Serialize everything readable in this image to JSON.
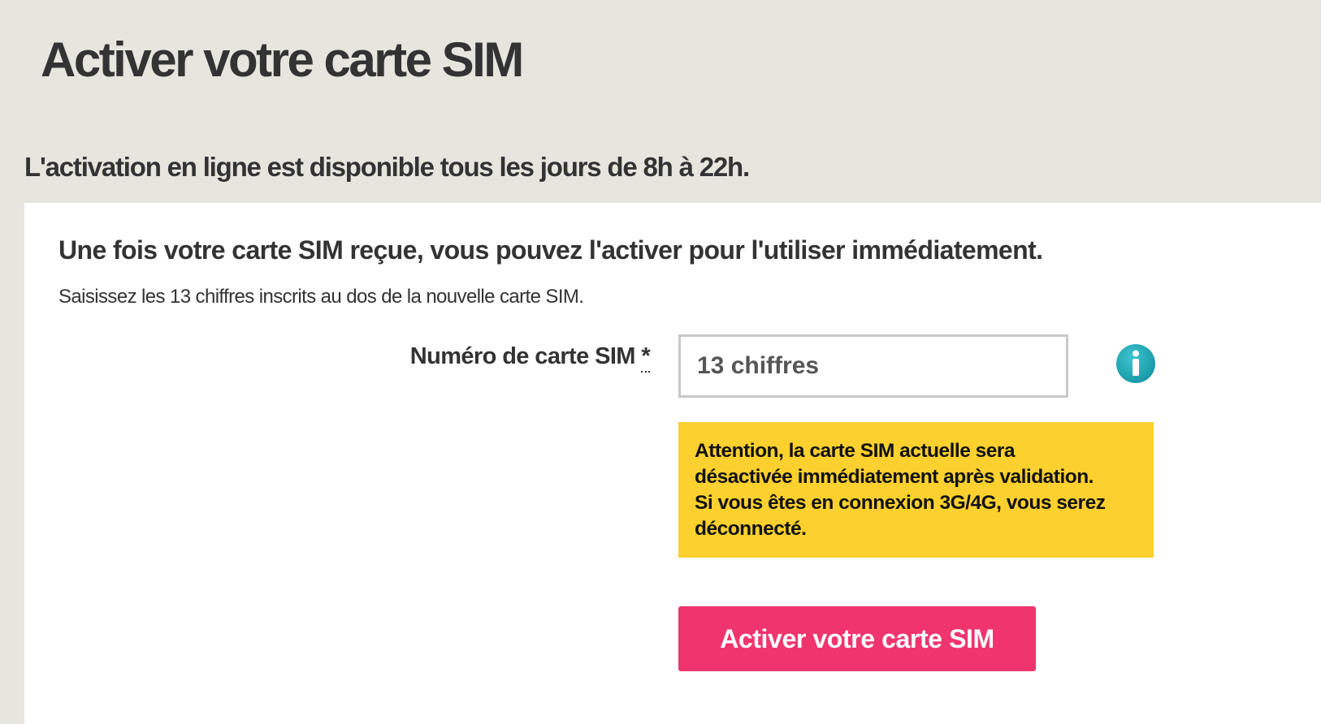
{
  "page": {
    "title": "Activer votre carte SIM",
    "availability": "L'activation en ligne est disponible tous les jours de 8h à 22h."
  },
  "panel": {
    "heading": "Une fois votre carte SIM reçue, vous pouvez l'activer pour l'utiliser immédiatement.",
    "instructions": "Saisissez les 13 chiffres inscrits au dos de la nouvelle carte SIM."
  },
  "form": {
    "sim_label": "Numéro de carte SIM",
    "required_mark": "*",
    "sim_placeholder": "13 chiffres",
    "sim_value": "",
    "info_icon": "info-icon",
    "info_icon_color": "#1a9aa8"
  },
  "warning": {
    "lines": [
      "Attention, la carte SIM actuelle sera",
      "désactivée immédiatement après validation.",
      "Si vous êtes en connexion 3G/4G, vous serez",
      "déconnecté."
    ],
    "background_color": "#fcd02e"
  },
  "actions": {
    "activate_label": "Activer votre carte SIM",
    "activate_color": "#f0346e"
  }
}
